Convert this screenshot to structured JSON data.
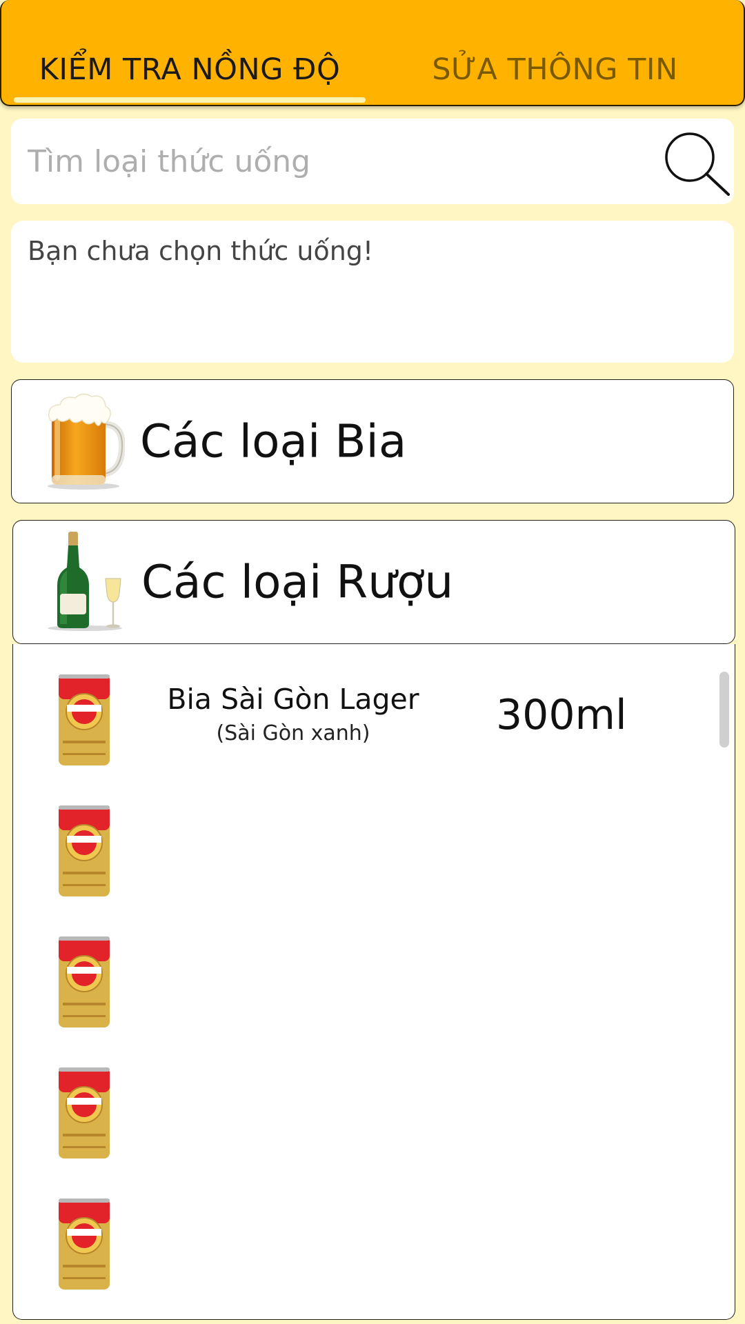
{
  "tabs": {
    "active_label": "KIỂM TRA NỒNG ĐỘ",
    "inactive_label": "SỬA THÔNG TIN"
  },
  "search": {
    "placeholder": "Tìm loại thức uống",
    "value": ""
  },
  "status": {
    "message": "Bạn chưa chọn thức uống!"
  },
  "categories": [
    {
      "label": "Các loại Bia",
      "icon": "beer-mug-icon"
    },
    {
      "label": "Các loại Rượu",
      "icon": "wine-bottle-icon"
    }
  ],
  "drinks": [
    {
      "name": "Bia Sài Gòn Lager",
      "sub": "(Sài Gòn xanh)",
      "volume": "300ml",
      "icon": "beer-can-icon"
    },
    {
      "name": "",
      "sub": "",
      "volume": "",
      "icon": "beer-can-icon"
    },
    {
      "name": "",
      "sub": "",
      "volume": "",
      "icon": "beer-can-icon"
    },
    {
      "name": "",
      "sub": "",
      "volume": "",
      "icon": "beer-can-icon"
    },
    {
      "name": "",
      "sub": "",
      "volume": "",
      "icon": "beer-can-icon"
    }
  ],
  "colors": {
    "header": "#FFB300",
    "background": "#FFF6C4",
    "can_red": "#E2232A",
    "can_gold": "#D9B24A"
  }
}
